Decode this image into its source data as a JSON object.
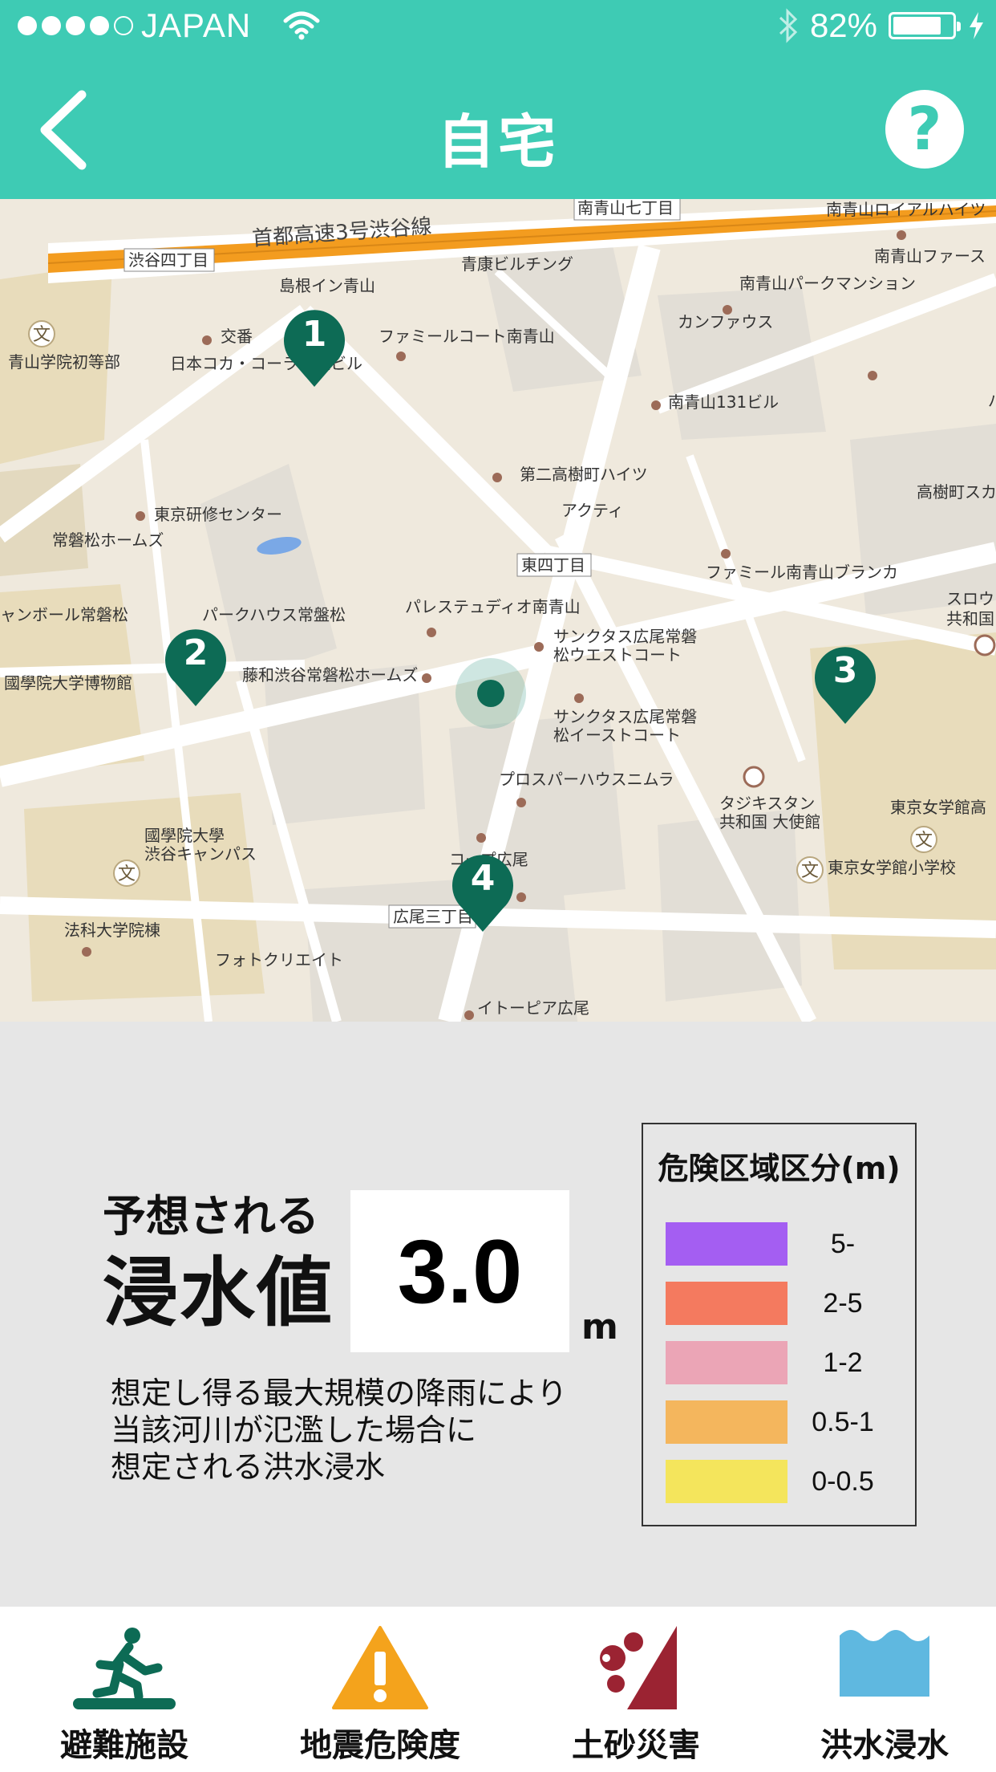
{
  "status_bar": {
    "carrier": "JAPAN",
    "battery": "82%",
    "battery_level": 0.82
  },
  "nav": {
    "title": "自宅",
    "help_glyph": "?"
  },
  "map": {
    "markers": [
      "1",
      "2",
      "3",
      "4"
    ],
    "labels": {
      "highway": "首都高速3号渋谷線",
      "shibuya4": "渋谷四丁目",
      "minami_aoyama7": "南青山七丁目",
      "minami_royal": "南青山ロイアルハイツ",
      "minami_first": "南青山ファース",
      "shimane": "島根イン青山",
      "seiko": "青康ビルチング",
      "minami_park": "南青山パークマンション",
      "koban": "交番",
      "kanfaus": "カンファウス",
      "aoyama_school": "青山学院初等部",
      "coca": "日本コカ・コーラ本社ビル",
      "famille": "ファミールコート南青山",
      "mb131": "南青山131ビル",
      "takaki2": "第二高樹町ハイツ",
      "takaki_sq": "高樹町スカ",
      "akuty": "アクティ",
      "training": "東京研修センター",
      "tokiwamatsu": "常磐松ホームズ",
      "higashi4": "東四丁目",
      "famille_blanca": "ファミール南青山ブランカ",
      "yanboru": "ャンボール常磐松",
      "park_house": "パークハウス常盤松",
      "palestudio": "パレステュディオ南青山",
      "sanctus_w1": "サンクタス広尾常磐",
      "sanctus_w2": "松ウエストコート",
      "fujiwa": "藤和渋谷常磐松ホームズ",
      "kokugakuin_museum": "國學院大学博物館",
      "sanctus_e1": "サンクタス広尾常磐",
      "sanctus_e2": "松イーストコート",
      "prosper": "プロスパーハウスニムラ",
      "tajik1": "タジキスタン",
      "tajik2": "共和国 大使館",
      "tjc_high": "東京女学館高",
      "kokugakuin1": "國學院大學",
      "kokugakuin2": "渋谷キャンパス",
      "hiroo_center": "コープ広尾",
      "tjc_elem": "東京女学館小学校",
      "hiroo3": "広尾三丁目",
      "hokka": "法科大学院棟",
      "photo": "フォトクリエイト",
      "itopia": "イトーピア広尾",
      "suro1": "スロウ",
      "suro2": "共和国",
      "paku": "パーク"
    }
  },
  "info": {
    "label_small": "予想される",
    "label_large": "浸水値",
    "value": "3.0",
    "unit": "m",
    "description": [
      "想定し得る最大規模の降雨により",
      "当該河川が氾濫した場合に",
      "想定される洪水浸水"
    ]
  },
  "legend": {
    "title": "危険区域区分(m)",
    "items": [
      {
        "color": "#a45ef2",
        "range": "5-"
      },
      {
        "color": "#f47a5f",
        "range": "2-5"
      },
      {
        "color": "#eba5b6",
        "range": "1-2"
      },
      {
        "color": "#f4b65d",
        "range": "0.5-1"
      },
      {
        "color": "#f4e55c",
        "range": "0-0.5"
      }
    ]
  },
  "tabs": [
    {
      "label": "避難施設",
      "icon": "evacuation-icon"
    },
    {
      "label": "地震危険度",
      "icon": "warning-icon"
    },
    {
      "label": "土砂災害",
      "icon": "landslide-icon"
    },
    {
      "label": "洪水浸水",
      "icon": "flood-icon"
    }
  ],
  "colors": {
    "accent": "#3ecbb4",
    "marker": "#0d6b55"
  }
}
